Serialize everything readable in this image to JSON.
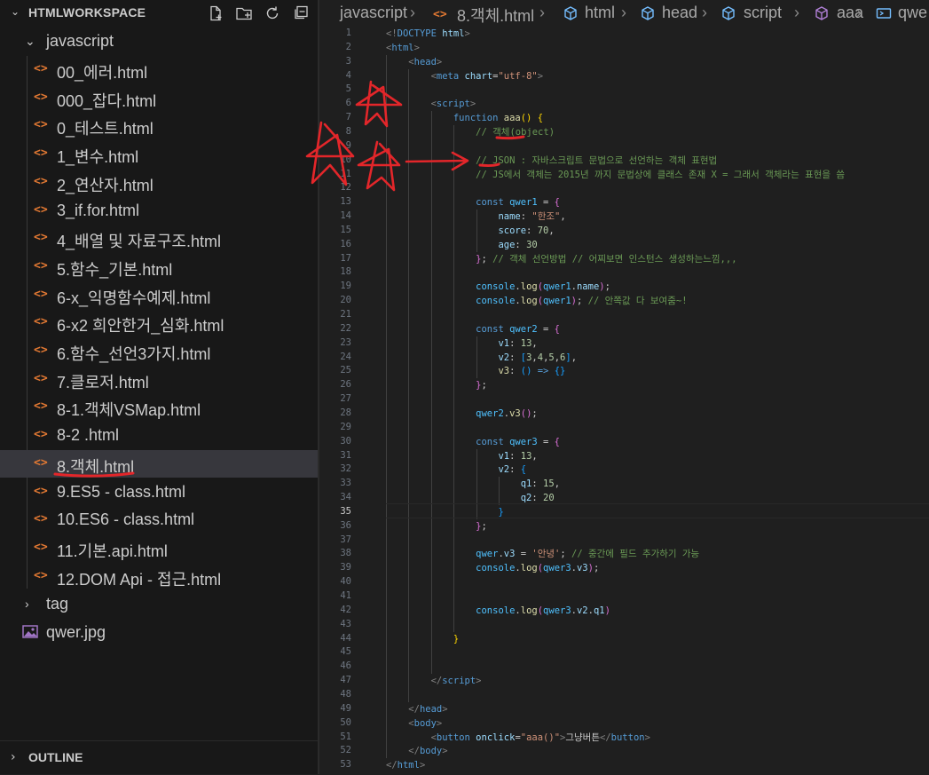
{
  "sidebar": {
    "title": "HTMLWORKSPACE",
    "folder": "javascript",
    "files": [
      "00_에러.html",
      "000_잡다.html",
      "0_테스트.html",
      "1_변수.html",
      "2_연산자.html",
      "3_if.for.html",
      "4_배열 및 자료구조.html",
      "5.함수_기본.html",
      "6-x_익명함수예제.html",
      "6-x2 희안한거_심화.html",
      "6.함수_선언3가지.html",
      "7.클로저.html",
      "8-1.객체VSMap.html",
      "8-2 .html",
      "8.객체.html",
      "9.ES5 - class.html",
      "10.ES6 - class.html",
      "11.기본.api.html",
      "12.DOM Api - 접근.html"
    ],
    "selected_index": 14,
    "tag_folder": "tag",
    "image_file": "qwer.jpg",
    "file_icon": "<>",
    "outline_label": "OUTLINE"
  },
  "breadcrumb": {
    "items": [
      "javascript",
      "8.객체.html",
      "html",
      "head",
      "script",
      "aaa",
      "qwe"
    ]
  },
  "editor": {
    "active_line": 35,
    "lines": [
      [
        [
          "tk-br",
          "<!"
        ],
        [
          "tk-tag",
          "DOCTYPE"
        ],
        [
          "tk-txt",
          " "
        ],
        [
          "tk-attr",
          "html"
        ],
        [
          "tk-br",
          ">"
        ]
      ],
      [
        [
          "tk-br",
          "<"
        ],
        [
          "tk-tag",
          "html"
        ],
        [
          "tk-br",
          ">"
        ]
      ],
      [
        [
          "tk-txt",
          "    "
        ],
        [
          "tk-br",
          "<"
        ],
        [
          "tk-tag",
          "head"
        ],
        [
          "tk-br",
          ">"
        ]
      ],
      [
        [
          "tk-txt",
          "        "
        ],
        [
          "tk-br",
          "<"
        ],
        [
          "tk-tag",
          "meta"
        ],
        [
          "tk-txt",
          " "
        ],
        [
          "tk-attr",
          "chart"
        ],
        [
          "tk-txt",
          "="
        ],
        [
          "tk-str",
          "\"utf-8\""
        ],
        [
          "tk-br",
          ">"
        ]
      ],
      [],
      [
        [
          "tk-txt",
          "        "
        ],
        [
          "tk-br",
          "<"
        ],
        [
          "tk-tag",
          "script"
        ],
        [
          "tk-br",
          ">"
        ]
      ],
      [
        [
          "tk-txt",
          "            "
        ],
        [
          "tk-kw",
          "function"
        ],
        [
          "tk-txt",
          " "
        ],
        [
          "tk-fn",
          "aaa"
        ],
        [
          "tk-brk1",
          "()"
        ],
        [
          "tk-txt",
          " "
        ],
        [
          "tk-brk1",
          "{"
        ]
      ],
      [
        [
          "tk-txt",
          "                "
        ],
        [
          "tk-com",
          "// 객체(object)"
        ]
      ],
      [],
      [
        [
          "tk-txt",
          "                "
        ],
        [
          "tk-com",
          "// JSON : 자바스크립트 문법으로 선언하는 객체 표현법"
        ]
      ],
      [
        [
          "tk-txt",
          "                "
        ],
        [
          "tk-com",
          "// JS에서 객체는 2015년 까지 문법상에 클래스 존재 X = 그래서 객체라는 표현을 씀"
        ]
      ],
      [],
      [
        [
          "tk-txt",
          "                "
        ],
        [
          "tk-kw",
          "const"
        ],
        [
          "tk-txt",
          " "
        ],
        [
          "tk-var",
          "qwer1"
        ],
        [
          "tk-txt",
          " = "
        ],
        [
          "tk-brk2",
          "{"
        ]
      ],
      [
        [
          "tk-txt",
          "                    "
        ],
        [
          "tk-prop",
          "name"
        ],
        [
          "tk-txt",
          ": "
        ],
        [
          "tk-str",
          "\"한조\""
        ],
        [
          "tk-txt",
          ","
        ]
      ],
      [
        [
          "tk-txt",
          "                    "
        ],
        [
          "tk-prop",
          "score"
        ],
        [
          "tk-txt",
          ": "
        ],
        [
          "tk-num",
          "70"
        ],
        [
          "tk-txt",
          ","
        ]
      ],
      [
        [
          "tk-txt",
          "                    "
        ],
        [
          "tk-prop",
          "age"
        ],
        [
          "tk-txt",
          ": "
        ],
        [
          "tk-num",
          "30"
        ]
      ],
      [
        [
          "tk-txt",
          "                "
        ],
        [
          "tk-brk2",
          "}"
        ],
        [
          "tk-txt",
          "; "
        ],
        [
          "tk-com",
          "// 객체 선언방법 // 어찌보면 인스턴스 생성하는느낌,,,"
        ]
      ],
      [],
      [
        [
          "tk-txt",
          "                "
        ],
        [
          "tk-var",
          "console"
        ],
        [
          "tk-txt",
          "."
        ],
        [
          "tk-fn",
          "log"
        ],
        [
          "tk-brk2",
          "("
        ],
        [
          "tk-var",
          "qwer1"
        ],
        [
          "tk-txt",
          "."
        ],
        [
          "tk-prop",
          "name"
        ],
        [
          "tk-brk2",
          ")"
        ],
        [
          "tk-txt",
          ";"
        ]
      ],
      [
        [
          "tk-txt",
          "                "
        ],
        [
          "tk-var",
          "console"
        ],
        [
          "tk-txt",
          "."
        ],
        [
          "tk-fn",
          "log"
        ],
        [
          "tk-brk2",
          "("
        ],
        [
          "tk-var",
          "qwer1"
        ],
        [
          "tk-brk2",
          ")"
        ],
        [
          "tk-txt",
          "; "
        ],
        [
          "tk-com",
          "// 안쪽값 다 보여줌~!"
        ]
      ],
      [],
      [
        [
          "tk-txt",
          "                "
        ],
        [
          "tk-kw",
          "const"
        ],
        [
          "tk-txt",
          " "
        ],
        [
          "tk-var",
          "qwer2"
        ],
        [
          "tk-txt",
          " = "
        ],
        [
          "tk-brk2",
          "{"
        ]
      ],
      [
        [
          "tk-txt",
          "                    "
        ],
        [
          "tk-prop",
          "v1"
        ],
        [
          "tk-txt",
          ": "
        ],
        [
          "tk-num",
          "13"
        ],
        [
          "tk-txt",
          ","
        ]
      ],
      [
        [
          "tk-txt",
          "                    "
        ],
        [
          "tk-prop",
          "v2"
        ],
        [
          "tk-txt",
          ": "
        ],
        [
          "tk-brk3",
          "["
        ],
        [
          "tk-num",
          "3"
        ],
        [
          "tk-txt",
          ","
        ],
        [
          "tk-num",
          "4"
        ],
        [
          "tk-txt",
          ","
        ],
        [
          "tk-num",
          "5"
        ],
        [
          "tk-txt",
          ","
        ],
        [
          "tk-num",
          "6"
        ],
        [
          "tk-brk3",
          "]"
        ],
        [
          "tk-txt",
          ","
        ]
      ],
      [
        [
          "tk-txt",
          "                    "
        ],
        [
          "tk-fn",
          "v3"
        ],
        [
          "tk-txt",
          ": "
        ],
        [
          "tk-brk3",
          "()"
        ],
        [
          "tk-txt",
          " "
        ],
        [
          "tk-kw",
          "=>"
        ],
        [
          "tk-txt",
          " "
        ],
        [
          "tk-brk3",
          "{}"
        ]
      ],
      [
        [
          "tk-txt",
          "                "
        ],
        [
          "tk-brk2",
          "}"
        ],
        [
          "tk-txt",
          ";"
        ]
      ],
      [],
      [
        [
          "tk-txt",
          "                "
        ],
        [
          "tk-var",
          "qwer2"
        ],
        [
          "tk-txt",
          "."
        ],
        [
          "tk-fn",
          "v3"
        ],
        [
          "tk-brk2",
          "()"
        ],
        [
          "tk-txt",
          ";"
        ]
      ],
      [],
      [
        [
          "tk-txt",
          "                "
        ],
        [
          "tk-kw",
          "const"
        ],
        [
          "tk-txt",
          " "
        ],
        [
          "tk-var",
          "qwer3"
        ],
        [
          "tk-txt",
          " = "
        ],
        [
          "tk-brk2",
          "{"
        ]
      ],
      [
        [
          "tk-txt",
          "                    "
        ],
        [
          "tk-prop",
          "v1"
        ],
        [
          "tk-txt",
          ": "
        ],
        [
          "tk-num",
          "13"
        ],
        [
          "tk-txt",
          ","
        ]
      ],
      [
        [
          "tk-txt",
          "                    "
        ],
        [
          "tk-prop",
          "v2"
        ],
        [
          "tk-txt",
          ": "
        ],
        [
          "tk-brk3",
          "{"
        ]
      ],
      [
        [
          "tk-txt",
          "                        "
        ],
        [
          "tk-prop",
          "q1"
        ],
        [
          "tk-txt",
          ": "
        ],
        [
          "tk-num",
          "15"
        ],
        [
          "tk-txt",
          ","
        ]
      ],
      [
        [
          "tk-txt",
          "                        "
        ],
        [
          "tk-prop",
          "q2"
        ],
        [
          "tk-txt",
          ": "
        ],
        [
          "tk-num",
          "20"
        ]
      ],
      [
        [
          "tk-txt",
          "                    "
        ],
        [
          "tk-brk3",
          "}"
        ]
      ],
      [
        [
          "tk-txt",
          "                "
        ],
        [
          "tk-brk2",
          "}"
        ],
        [
          "tk-txt",
          ";"
        ]
      ],
      [],
      [
        [
          "tk-txt",
          "                "
        ],
        [
          "tk-var",
          "qwer"
        ],
        [
          "tk-txt",
          "."
        ],
        [
          "tk-prop",
          "v3"
        ],
        [
          "tk-txt",
          " = "
        ],
        [
          "tk-str",
          "'안녕'"
        ],
        [
          "tk-txt",
          "; "
        ],
        [
          "tk-com",
          "// 중간에 필드 추가하기 가능"
        ]
      ],
      [
        [
          "tk-txt",
          "                "
        ],
        [
          "tk-var",
          "console"
        ],
        [
          "tk-txt",
          "."
        ],
        [
          "tk-fn",
          "log"
        ],
        [
          "tk-brk2",
          "("
        ],
        [
          "tk-var",
          "qwer3"
        ],
        [
          "tk-txt",
          "."
        ],
        [
          "tk-prop",
          "v3"
        ],
        [
          "tk-brk2",
          ")"
        ],
        [
          "tk-txt",
          ";"
        ]
      ],
      [],
      [],
      [
        [
          "tk-txt",
          "                "
        ],
        [
          "tk-var",
          "console"
        ],
        [
          "tk-txt",
          "."
        ],
        [
          "tk-fn",
          "log"
        ],
        [
          "tk-brk2",
          "("
        ],
        [
          "tk-var",
          "qwer3"
        ],
        [
          "tk-txt",
          "."
        ],
        [
          "tk-prop",
          "v2"
        ],
        [
          "tk-txt",
          "."
        ],
        [
          "tk-prop",
          "q1"
        ],
        [
          "tk-brk2",
          ")"
        ]
      ],
      [],
      [
        [
          "tk-txt",
          "            "
        ],
        [
          "tk-brk1",
          "}"
        ]
      ],
      [],
      [],
      [
        [
          "tk-txt",
          "        "
        ],
        [
          "tk-br",
          "</"
        ],
        [
          "tk-tag",
          "script"
        ],
        [
          "tk-br",
          ">"
        ]
      ],
      [],
      [
        [
          "tk-txt",
          "    "
        ],
        [
          "tk-br",
          "</"
        ],
        [
          "tk-tag",
          "head"
        ],
        [
          "tk-br",
          ">"
        ]
      ],
      [
        [
          "tk-txt",
          "    "
        ],
        [
          "tk-br",
          "<"
        ],
        [
          "tk-tag",
          "body"
        ],
        [
          "tk-br",
          ">"
        ]
      ],
      [
        [
          "tk-txt",
          "        "
        ],
        [
          "tk-br",
          "<"
        ],
        [
          "tk-tag",
          "button"
        ],
        [
          "tk-txt",
          " "
        ],
        [
          "tk-attr",
          "onclick"
        ],
        [
          "tk-txt",
          "="
        ],
        [
          "tk-str",
          "\"aaa()\""
        ],
        [
          "tk-br",
          ">"
        ],
        [
          "tk-txt",
          "그냥버튼"
        ],
        [
          "tk-br",
          "</"
        ],
        [
          "tk-tag",
          "button"
        ],
        [
          "tk-br",
          ">"
        ]
      ],
      [
        [
          "tk-txt",
          "    "
        ],
        [
          "tk-br",
          "</"
        ],
        [
          "tk-tag",
          "body"
        ],
        [
          "tk-br",
          ">"
        ]
      ],
      [
        [
          "tk-br",
          "</"
        ],
        [
          "tk-tag",
          "html"
        ],
        [
          "tk-br",
          ">"
        ]
      ]
    ]
  },
  "colors": {
    "annotation": "#e3262a",
    "selection": "#37373d",
    "file_icon": "#e37933"
  }
}
